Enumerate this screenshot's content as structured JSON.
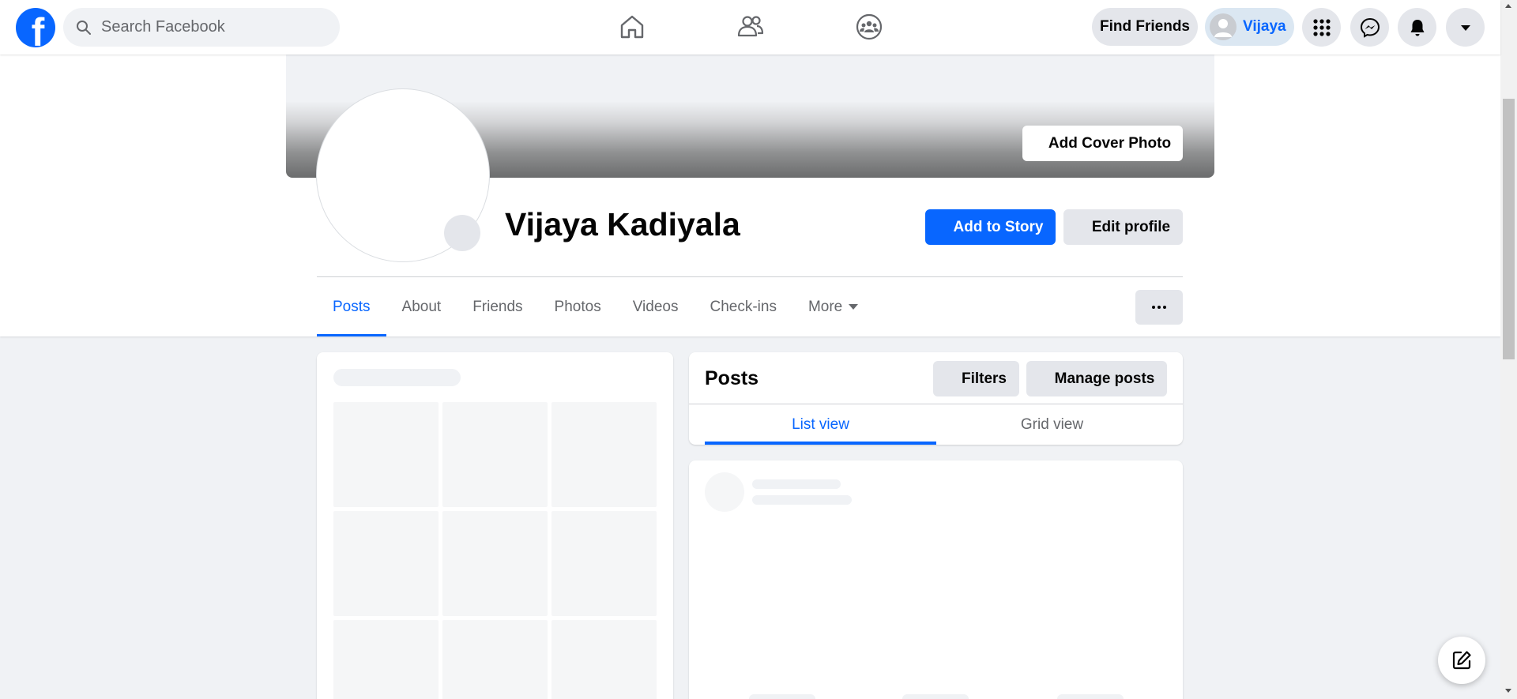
{
  "topnav": {
    "logo_letter": "f",
    "search_placeholder": "Search Facebook",
    "icons": [
      "home-icon",
      "friends-icon",
      "groups-icon"
    ],
    "find_friends_label": "Find Friends",
    "profile_label": "Vijaya",
    "round_buttons": [
      "menu-grid-icon",
      "messenger-icon",
      "notifications-icon",
      "account-caret-icon"
    ]
  },
  "profile": {
    "add_cover_label": "Add Cover Photo",
    "name": "Vijaya Kadiyala",
    "add_story_label": "Add to Story",
    "edit_profile_label": "Edit profile",
    "tabs": [
      {
        "label": "Posts",
        "active": true
      },
      {
        "label": "About"
      },
      {
        "label": "Friends"
      },
      {
        "label": "Photos"
      },
      {
        "label": "Videos"
      },
      {
        "label": "Check-ins"
      },
      {
        "label": "More"
      }
    ]
  },
  "posts": {
    "title": "Posts",
    "filters_label": "Filters",
    "manage_label": "Manage posts",
    "views": [
      {
        "label": "List view",
        "active": true
      },
      {
        "label": "Grid view"
      }
    ]
  },
  "colors": {
    "accent": "#0866ff",
    "page_bg": "#f0f2f5",
    "button_gray": "#e4e6eb",
    "text_secondary": "#65676b"
  }
}
